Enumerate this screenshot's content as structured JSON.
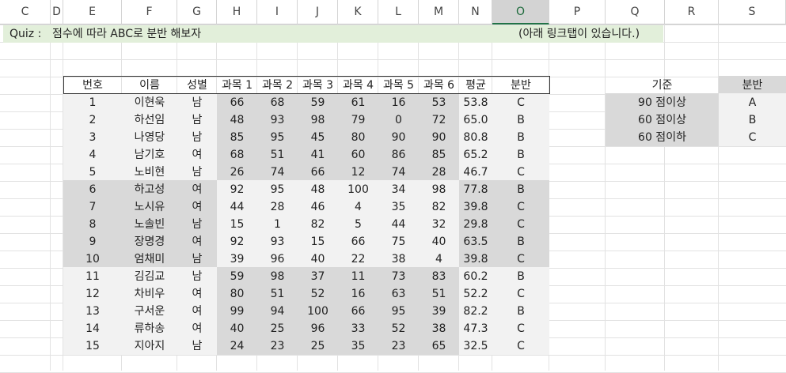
{
  "columns": [
    "C",
    "D",
    "E",
    "F",
    "G",
    "H",
    "I",
    "J",
    "K",
    "L",
    "M",
    "N",
    "O",
    "P",
    "Q",
    "R",
    "S"
  ],
  "selected_column": "O",
  "quiz": {
    "label": "Quiz :",
    "text": "점수에 따라 ABC로 분반 해보자",
    "note": "(아래 링크탭이 있습니다.)"
  },
  "table": {
    "headers": [
      "번호",
      "이름",
      "성별",
      "과목 1",
      "과목 2",
      "과목 3",
      "과목 4",
      "과목 5",
      "과목 6",
      "평균",
      "분반"
    ],
    "rows": [
      [
        "1",
        "이현욱",
        "남",
        "66",
        "68",
        "59",
        "61",
        "16",
        "53",
        "53.8",
        "C"
      ],
      [
        "2",
        "하선임",
        "남",
        "48",
        "93",
        "98",
        "79",
        "0",
        "72",
        "65.0",
        "B"
      ],
      [
        "3",
        "나영당",
        "남",
        "85",
        "95",
        "45",
        "80",
        "90",
        "90",
        "80.8",
        "B"
      ],
      [
        "4",
        "남기호",
        "여",
        "68",
        "51",
        "41",
        "60",
        "86",
        "85",
        "65.2",
        "B"
      ],
      [
        "5",
        "노비현",
        "남",
        "26",
        "74",
        "66",
        "12",
        "74",
        "28",
        "46.7",
        "C"
      ],
      [
        "6",
        "하고성",
        "여",
        "92",
        "95",
        "48",
        "100",
        "34",
        "98",
        "77.8",
        "B"
      ],
      [
        "7",
        "노시유",
        "여",
        "44",
        "28",
        "46",
        "4",
        "35",
        "82",
        "39.8",
        "C"
      ],
      [
        "8",
        "노솔빈",
        "남",
        "15",
        "1",
        "82",
        "5",
        "44",
        "32",
        "29.8",
        "C"
      ],
      [
        "9",
        "장명경",
        "여",
        "92",
        "93",
        "15",
        "66",
        "75",
        "40",
        "63.5",
        "B"
      ],
      [
        "10",
        "엄채미",
        "남",
        "39",
        "96",
        "40",
        "22",
        "38",
        "4",
        "39.8",
        "C"
      ],
      [
        "11",
        "김김교",
        "남",
        "59",
        "98",
        "37",
        "11",
        "73",
        "83",
        "60.2",
        "B"
      ],
      [
        "12",
        "차비우",
        "여",
        "80",
        "51",
        "52",
        "16",
        "63",
        "51",
        "52.2",
        "C"
      ],
      [
        "13",
        "구서운",
        "여",
        "99",
        "94",
        "100",
        "66",
        "95",
        "39",
        "82.2",
        "B"
      ],
      [
        "14",
        "류하송",
        "여",
        "40",
        "25",
        "96",
        "33",
        "52",
        "38",
        "47.3",
        "C"
      ],
      [
        "15",
        "지아지",
        "남",
        "24",
        "23",
        "25",
        "35",
        "23",
        "65",
        "32.5",
        "C"
      ]
    ]
  },
  "criteria": {
    "headers": [
      "기준",
      "분반"
    ],
    "rows": [
      [
        "90 점이상",
        "A"
      ],
      [
        "60 점이상",
        "B"
      ],
      [
        "60 점이하",
        "C"
      ]
    ]
  },
  "colors": {
    "quiz_band": "#e2efda",
    "light_fill": "#f2f2f2",
    "dark_fill": "#d9d9d9",
    "selected_header": "#d3d3d3",
    "accent_green": "#217346"
  }
}
